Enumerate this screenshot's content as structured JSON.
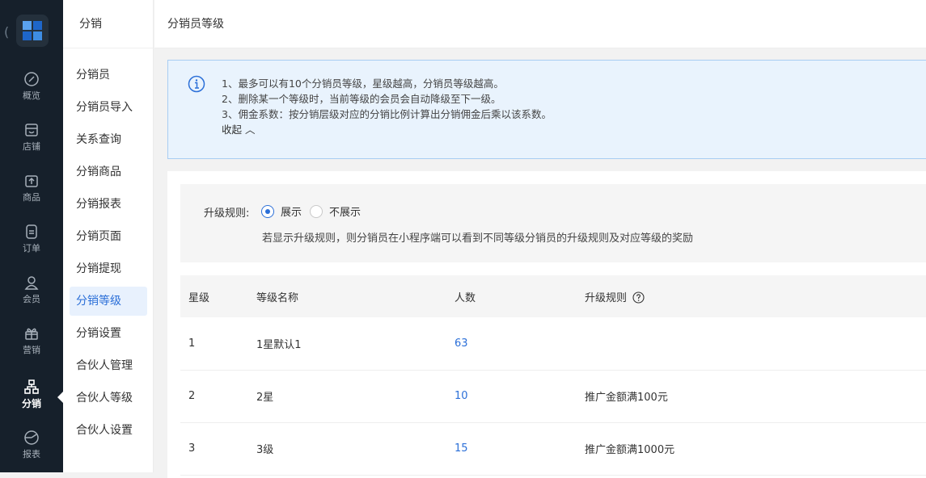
{
  "rail": {
    "items": [
      {
        "label": "概览",
        "icon": "dashboard-icon"
      },
      {
        "label": "店铺",
        "icon": "store-icon"
      },
      {
        "label": "商品",
        "icon": "box-icon"
      },
      {
        "label": "订单",
        "icon": "order-icon"
      },
      {
        "label": "会员",
        "icon": "user-icon"
      },
      {
        "label": "营销",
        "icon": "gift-icon"
      },
      {
        "label": "分销",
        "icon": "distribution-icon",
        "active": true
      },
      {
        "label": "报表",
        "icon": "chart-icon"
      }
    ]
  },
  "submenu": {
    "title": "分销",
    "items": [
      "分销员",
      "分销员导入",
      "关系查询",
      "分销商品",
      "分销报表",
      "分销页面",
      "分销提现",
      "分销等级",
      "分销设置",
      "合伙人管理",
      "合伙人等级",
      "合伙人设置"
    ],
    "active_index": 7
  },
  "header": {
    "title": "分销员等级"
  },
  "notice": {
    "lines": [
      "1、最多可以有10个分销员等级，星级越高，分销员等级越高。",
      "2、删除某一个等级时，当前等级的会员会自动降级至下一级。",
      "3、佣金系数：按分销层级对应的分销比例计算出分销佣金后乘以该系数。"
    ],
    "collapse_label": "收起 ︿"
  },
  "upgrade_rule": {
    "label": "升级规则:",
    "option_show": "展示",
    "option_hide": "不展示",
    "selected": "show",
    "description": "若显示升级规则，则分销员在小程序端可以看到不同等级分销员的升级规则及对应等级的奖励"
  },
  "table": {
    "headers": [
      "星级",
      "等级名称",
      "人数",
      "升级规则"
    ],
    "rows": [
      {
        "star": "1",
        "name": "1星默认1",
        "count": "63",
        "rule": ""
      },
      {
        "star": "2",
        "name": "2星",
        "count": "10",
        "rule": "推广金额满100元"
      },
      {
        "star": "3",
        "name": "3级",
        "count": "15",
        "rule": "推广金额满1000元"
      }
    ]
  },
  "colors": {
    "accent": "#2b6fd8",
    "rail_bg": "#16202b",
    "notice_bg": "#e9f3fd"
  }
}
